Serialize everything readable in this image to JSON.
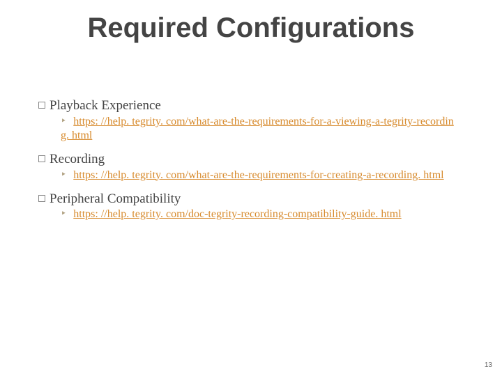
{
  "title": "Required Configurations",
  "items": [
    {
      "label": "Playback Experience",
      "link": "https: //help. tegrity. com/what-are-the-requirements-for-a-viewing-a-tegrity-recording. html"
    },
    {
      "label": "Recording",
      "link": "https: //help. tegrity. com/what-are-the-requirements-for-creating-a-recording. html"
    },
    {
      "label": "Peripheral Compatibility",
      "link": "https: //help. tegrity. com/doc-tegrity-recording-compatibility-guide. html"
    }
  ],
  "page_number": "13"
}
